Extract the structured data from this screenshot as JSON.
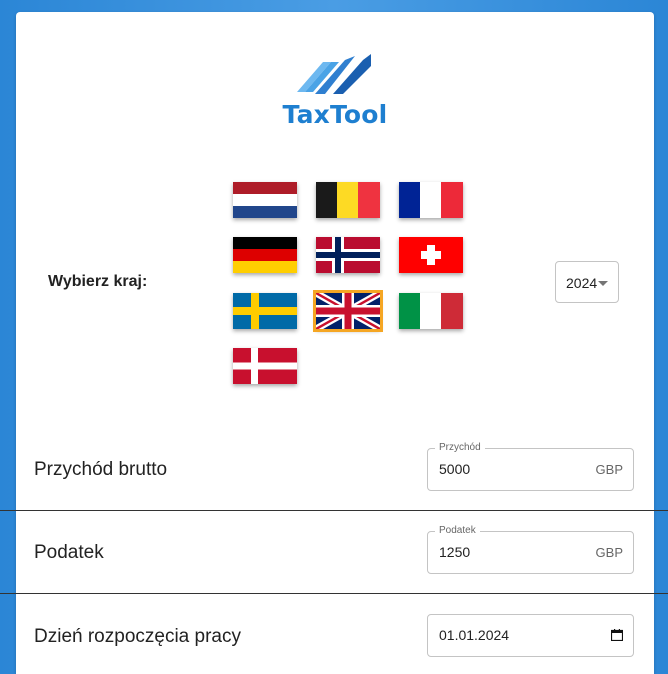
{
  "brand": {
    "name": "TaxTool"
  },
  "country_selector": {
    "label": "Wybierz kraj:",
    "flags": [
      {
        "country": "Netherlands",
        "icon": "netherlands-flag-icon",
        "selected": false
      },
      {
        "country": "Belgium",
        "icon": "belgium-flag-icon",
        "selected": false
      },
      {
        "country": "France",
        "icon": "france-flag-icon",
        "selected": false
      },
      {
        "country": "Germany",
        "icon": "germany-flag-icon",
        "selected": false
      },
      {
        "country": "Norway",
        "icon": "norway-flag-icon",
        "selected": false
      },
      {
        "country": "Switzerland",
        "icon": "switzerland-flag-icon",
        "selected": false
      },
      {
        "country": "Sweden",
        "icon": "sweden-flag-icon",
        "selected": false
      },
      {
        "country": "United Kingdom",
        "icon": "uk-flag-icon",
        "selected": true
      },
      {
        "country": "Italy",
        "icon": "italy-flag-icon",
        "selected": false
      },
      {
        "country": "Denmark",
        "icon": "denmark-flag-icon",
        "selected": false
      }
    ],
    "selected_highlight_color": "#f5a623"
  },
  "year_select": {
    "value": "2024"
  },
  "income": {
    "row_label": "Przychód brutto",
    "field_label": "Przychód",
    "value": "5000",
    "currency": "GBP"
  },
  "tax": {
    "row_label": "Podatek",
    "field_label": "Podatek",
    "value": "1250",
    "currency": "GBP"
  },
  "start_date": {
    "row_label": "Dzień rozpoczęcia pracy",
    "value": "01.01.2024"
  },
  "colors": {
    "brand": "#1e7fd0",
    "background": "#2b86d6"
  }
}
